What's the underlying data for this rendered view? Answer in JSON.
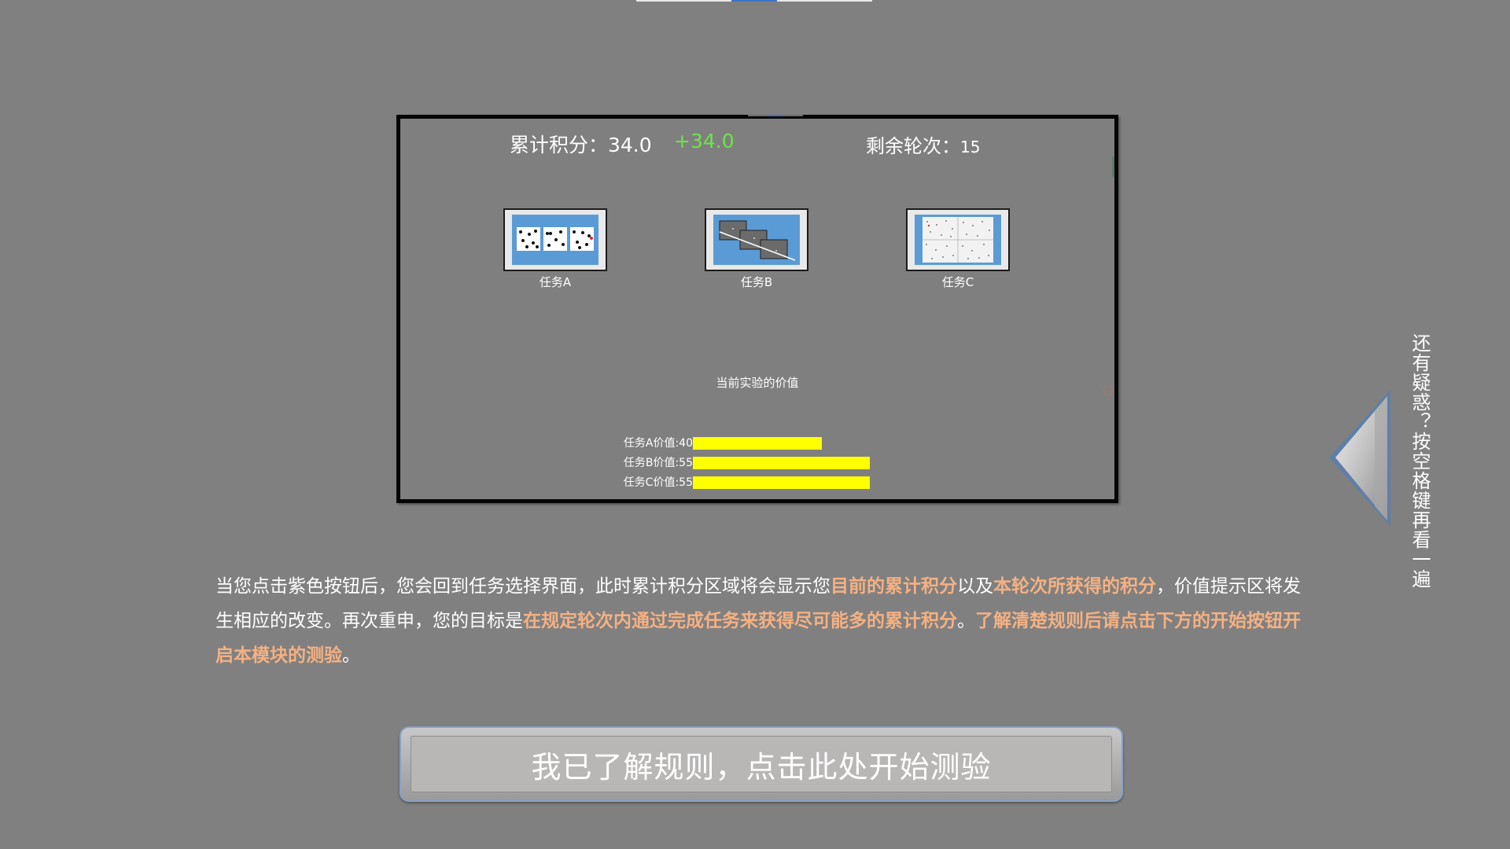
{
  "demo": {
    "score_label": "累计积分：34.0",
    "score_delta": "+34.0",
    "rounds_label": "剩余轮次：",
    "rounds_value": "15",
    "tasks": [
      {
        "label": "任务A",
        "thumb_icon": "dot-cards-thumbnail"
      },
      {
        "label": "任务B",
        "thumb_icon": "stacked-cards-thumbnail"
      },
      {
        "label": "任务C",
        "thumb_icon": "number-grid-thumbnail"
      }
    ],
    "value_title": "当前实验的价值",
    "values": [
      {
        "label": "任务A价值:40",
        "value": 40
      },
      {
        "label": "任务B价值:55",
        "value": 55
      },
      {
        "label": "任务C价值:55",
        "value": 55
      }
    ],
    "value_bar_color": "#ffff00"
  },
  "explanation": {
    "part1": "当您点击紫色按钮后，您会回到任务选择界面，此时累计积分区域将会显示您",
    "hl1": "目前的累计积分",
    "part2": "以及",
    "hl2": "本轮次所获得的积分",
    "part3": "，价值提示区将发生相应的改变。再次重申，您的目标是",
    "hl3": "在规定轮次内通过完成任务来获得尽可能多的累计积分",
    "part4": "。",
    "hl4": "了解清楚规则后请点击下方的开始按钮开启本模块的测验",
    "part5": "。",
    "highlight_color": "#f4b183"
  },
  "start_button": {
    "label": "我已了解规则，点击此处开始测验"
  },
  "replay": {
    "label": "还有疑惑？按空格键再看一遍",
    "icon": "left-arrow-icon"
  }
}
